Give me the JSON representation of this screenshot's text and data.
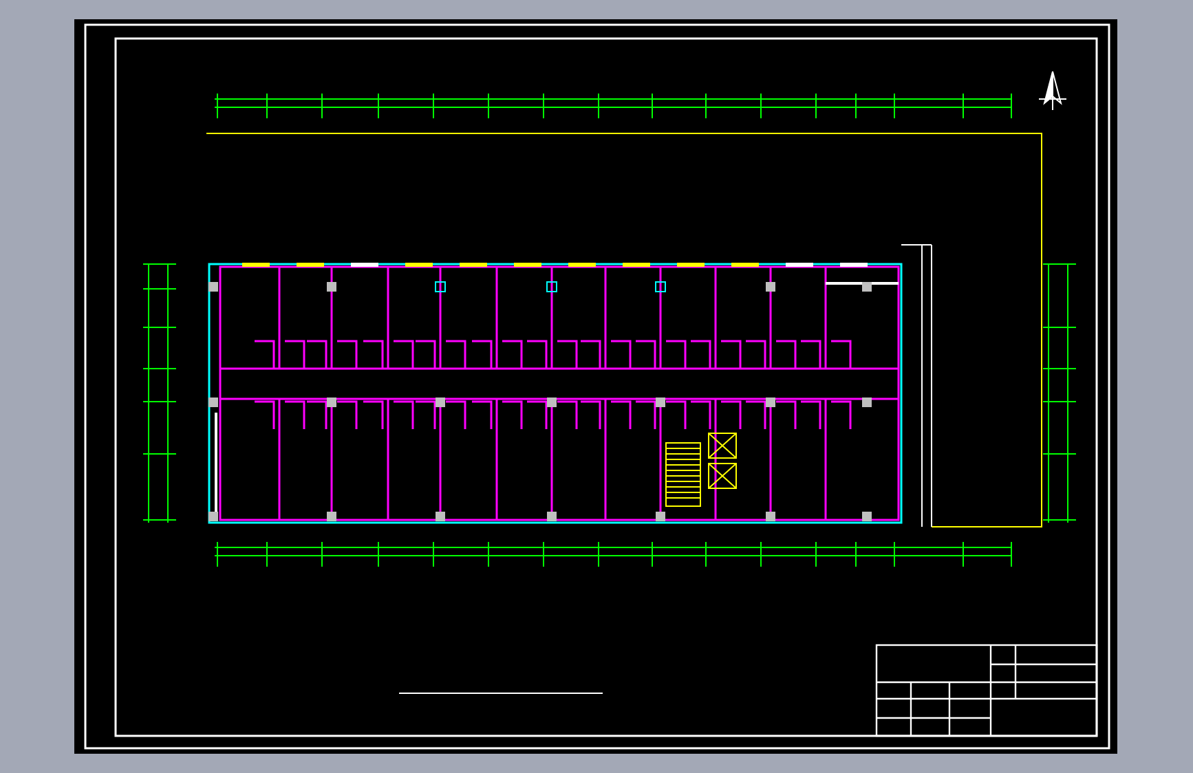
{
  "floor_plan": {
    "top_windows": [
      {
        "color": "#ffff00"
      },
      {
        "color": "#ffff00"
      },
      {
        "color": "#ffffff"
      },
      {
        "color": "#ffff00"
      },
      {
        "color": "#ffff00"
      },
      {
        "color": "#ffff00"
      },
      {
        "color": "#ffff00"
      },
      {
        "color": "#ffff00"
      },
      {
        "color": "#ffff00"
      },
      {
        "color": "#ffff00"
      },
      {
        "color": "#ffffff"
      },
      {
        "color": "#ffffff"
      }
    ],
    "top_columns": [
      {
        "kind": "solid"
      },
      {
        "kind": "solid"
      },
      {
        "kind": "hollow"
      },
      {
        "kind": "hollow"
      },
      {
        "kind": "hollow"
      },
      {
        "kind": "solid"
      },
      {
        "kind": "solid"
      }
    ]
  }
}
